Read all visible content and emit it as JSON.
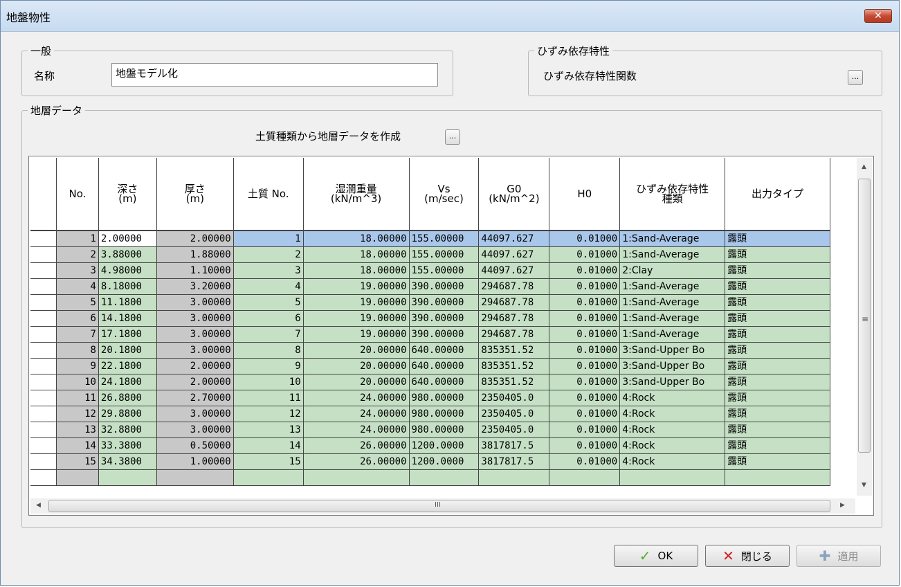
{
  "window": {
    "title": "地盤物性",
    "close_icon": "✕"
  },
  "general": {
    "legend": "一般",
    "name_label": "名称",
    "name_value": "地盤モデル化"
  },
  "strain": {
    "legend": "ひずみ依存特性",
    "function_label": "ひずみ依存特性関数",
    "button_label": "..."
  },
  "layers": {
    "legend": "地層データ",
    "create_label": "土質種類から地層データを作成",
    "create_button": "...",
    "headers": [
      "",
      "No.",
      "深さ\n(m)",
      "厚さ\n(m)",
      "土質 No.",
      "湿潤重量\n(kN/m^3)",
      "Vs\n(m/sec)",
      "G0\n(kN/m^2)",
      "H0",
      "ひずみ依存特性\n種類",
      "出力タイプ"
    ],
    "rows": [
      [
        "1",
        "2.00000",
        "2.00000",
        "1",
        "18.00000",
        "155.00000",
        "44097.627",
        "0.01000",
        "1:Sand-Average",
        "露頭"
      ],
      [
        "2",
        "3.88000",
        "1.88000",
        "2",
        "18.00000",
        "155.00000",
        "44097.627",
        "0.01000",
        "1:Sand-Average",
        "露頭"
      ],
      [
        "3",
        "4.98000",
        "1.10000",
        "3",
        "18.00000",
        "155.00000",
        "44097.627",
        "0.01000",
        "2:Clay",
        "露頭"
      ],
      [
        "4",
        "8.18000",
        "3.20000",
        "4",
        "19.00000",
        "390.00000",
        "294687.78",
        "0.01000",
        "1:Sand-Average",
        "露頭"
      ],
      [
        "5",
        "11.1800",
        "3.00000",
        "5",
        "19.00000",
        "390.00000",
        "294687.78",
        "0.01000",
        "1:Sand-Average",
        "露頭"
      ],
      [
        "6",
        "14.1800",
        "3.00000",
        "6",
        "19.00000",
        "390.00000",
        "294687.78",
        "0.01000",
        "1:Sand-Average",
        "露頭"
      ],
      [
        "7",
        "17.1800",
        "3.00000",
        "7",
        "19.00000",
        "390.00000",
        "294687.78",
        "0.01000",
        "1:Sand-Average",
        "露頭"
      ],
      [
        "8",
        "20.1800",
        "3.00000",
        "8",
        "20.00000",
        "640.00000",
        "835351.52",
        "0.01000",
        "3:Sand-Upper Bo",
        "露頭"
      ],
      [
        "9",
        "22.1800",
        "2.00000",
        "9",
        "20.00000",
        "640.00000",
        "835351.52",
        "0.01000",
        "3:Sand-Upper Bo",
        "露頭"
      ],
      [
        "10",
        "24.1800",
        "2.00000",
        "10",
        "20.00000",
        "640.00000",
        "835351.52",
        "0.01000",
        "3:Sand-Upper Bo",
        "露頭"
      ],
      [
        "11",
        "26.8800",
        "2.70000",
        "11",
        "24.00000",
        "980.00000",
        "2350405.0",
        "0.01000",
        "4:Rock",
        "露頭"
      ],
      [
        "12",
        "29.8800",
        "3.00000",
        "12",
        "24.00000",
        "980.00000",
        "2350405.0",
        "0.01000",
        "4:Rock",
        "露頭"
      ],
      [
        "13",
        "32.8800",
        "3.00000",
        "13",
        "24.00000",
        "980.00000",
        "2350405.0",
        "0.01000",
        "4:Rock",
        "露頭"
      ],
      [
        "14",
        "33.3800",
        "0.50000",
        "14",
        "26.00000",
        "1200.0000",
        "3817817.5",
        "0.01000",
        "4:Rock",
        "露頭"
      ],
      [
        "15",
        "34.3800",
        "1.00000",
        "15",
        "26.00000",
        "1200.0000",
        "3817817.5",
        "0.01000",
        "4:Rock",
        "露頭"
      ]
    ],
    "selected_row": 0
  },
  "scroll": {
    "up": "▲",
    "down": "▼",
    "left": "◀",
    "right": "▶",
    "v_grip": "≡",
    "h_grip": "III"
  },
  "buttons": {
    "ok": {
      "label": "OK",
      "icon": "✓"
    },
    "close": {
      "label": "閉じる",
      "icon": "✕"
    },
    "apply": {
      "label": "適用",
      "icon": "✚"
    }
  },
  "colors": {
    "row_selected": "#a9c7ea",
    "cell_green": "#c5e0c5",
    "cell_gray": "#c8c8c8",
    "ok_icon": "#4caf2a",
    "close_icon": "#d21d1d",
    "apply_icon": "#8aa3bd"
  }
}
